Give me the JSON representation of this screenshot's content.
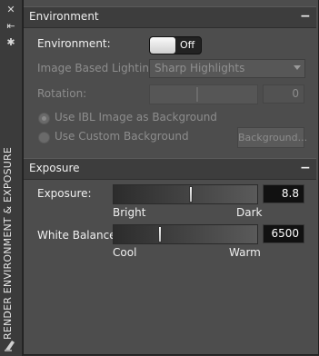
{
  "sidebar": {
    "title": "RENDER ENVIRONMENT & EXPOSURE",
    "icons": [
      "close-icon",
      "pin-icon",
      "gear-icon"
    ],
    "bottom_icon": "palette-icon"
  },
  "environment": {
    "header": "Environment",
    "collapse_symbol": "−",
    "environment_label": "Environment:",
    "toggle_state": "Off",
    "ibl_label": "Image Based Lighting:",
    "ibl_value": "Sharp Highlights",
    "rotation_label": "Rotation:",
    "rotation_value": "0",
    "rotation_fraction": 0.44,
    "radio_ibl_bg": "Use IBL Image as Background",
    "radio_custom_bg": "Use Custom Background",
    "background_button": "Background..."
  },
  "exposure": {
    "header": "Exposure",
    "collapse_symbol": "−",
    "exposure_label": "Exposure:",
    "exposure_value": "8.8",
    "exposure_fraction": 0.54,
    "exposure_left_caption": "Bright",
    "exposure_right_caption": "Dark",
    "white_balance_label": "White Balance:",
    "white_balance_value": "6500",
    "white_balance_fraction": 0.32,
    "white_balance_left_caption": "Cool",
    "white_balance_right_caption": "Warm"
  }
}
